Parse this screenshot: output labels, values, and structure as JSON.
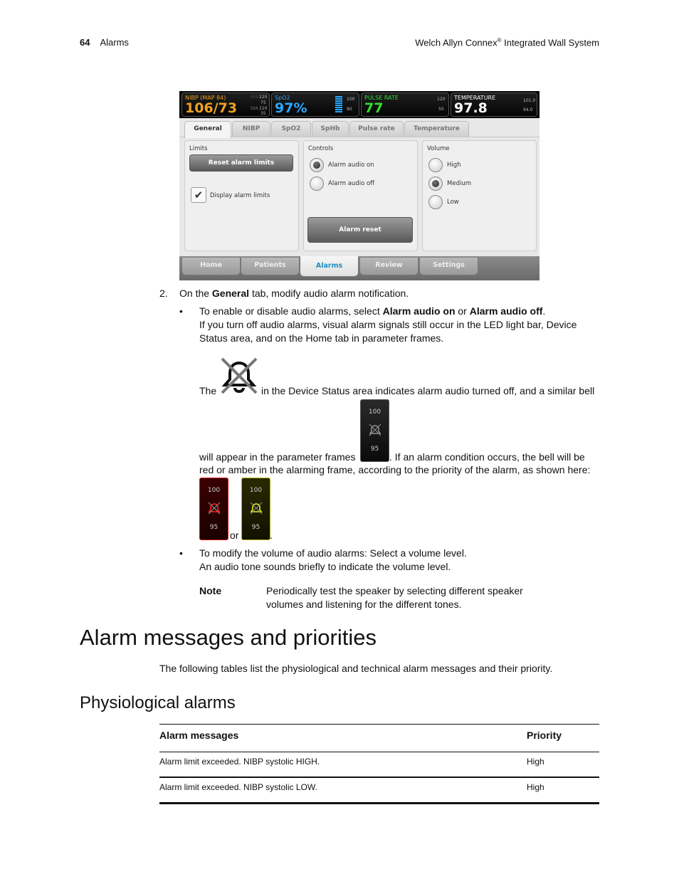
{
  "header": {
    "page_number": "64",
    "section": "Alarms",
    "product_prefix": "Welch Allyn Connex",
    "product_reg": "®",
    "product_suffix": " Integrated Wall System"
  },
  "device": {
    "vitals": [
      {
        "label": "NIBP (MAP 84)",
        "value": "106/73",
        "color": "#f0a020",
        "limits": [
          "SYS",
          "220",
          "75",
          "DIA",
          "110",
          "35"
        ]
      },
      {
        "label": "SpO2",
        "value": "97%",
        "color": "#28a8ff",
        "limits": [
          "100",
          "90"
        ]
      },
      {
        "label": "PULSE RATE",
        "value": "77",
        "color": "#30e030",
        "limits": [
          "120",
          "50"
        ]
      },
      {
        "label": "TEMPERATURE",
        "value": "97.8",
        "color": "#ffffff",
        "limits": [
          "101.0",
          "94.0"
        ]
      }
    ],
    "tabs": [
      "General",
      "NIBP",
      "SpO2",
      "SpHb",
      "Pulse rate",
      "Temperature"
    ],
    "active_tab": "General",
    "limits_panel": {
      "title": "Limits",
      "reset_button": "Reset alarm limits",
      "checkbox_label": "Display alarm limits",
      "checked": true
    },
    "controls_panel": {
      "title": "Controls",
      "options": [
        "Alarm audio on",
        "Alarm audio off"
      ],
      "selected": "Alarm audio on",
      "reset_button": "Alarm reset"
    },
    "volume_panel": {
      "title": "Volume",
      "options": [
        "High",
        "Medium",
        "Low"
      ],
      "selected": "Medium"
    },
    "nav_tabs": [
      "Home",
      "Patients",
      "Alarms",
      "Review",
      "Settings"
    ],
    "active_nav": "Alarms"
  },
  "step": {
    "number": "2.",
    "pre": "On the ",
    "bold": "General",
    "post": " tab, modify audio alarm notification.",
    "bullet1": {
      "a": "To enable or disable audio alarms, select ",
      "b1": "Alarm audio on",
      "c": " or ",
      "b2": "Alarm audio off",
      "d": ".",
      "line2": "If you turn off audio alarms, visual alarm signals still occur in the LED light bar, Device",
      "line3": "Status area, and on the Home tab in parameter frames.",
      "the": "The",
      "after_bell": "in the Device Status area indicates alarm audio turned off, and a similar bell",
      "will_appear": "will appear in the parameter frames",
      "if_alarm": ". If an alarm condition occurs, the bell will be",
      "red_or_amber": "red or amber in the alarming frame, according to the priority of the alarm, as shown here:",
      "or": "or",
      "period": "."
    },
    "frames": {
      "upper": "100",
      "lower": "95",
      "red": "#e01010",
      "amber": "#e0e010"
    },
    "bullet2": {
      "line1": "To modify the volume of audio alarms: Select a volume level.",
      "line2": "An audio tone sounds briefly to indicate the volume level."
    },
    "note": {
      "label": "Note",
      "line1": "Periodically test the speaker by selecting different speaker",
      "line2": "volumes and listening for the different tones."
    }
  },
  "section_title": "Alarm messages and priorities",
  "section_intro": "The following tables list the physiological and technical alarm messages and their priority.",
  "subsection_title": "Physiological alarms",
  "table": {
    "headers": [
      "Alarm messages",
      "Priority"
    ],
    "rows": [
      [
        "Alarm limit exceeded. NIBP systolic HIGH.",
        "High"
      ],
      [
        "Alarm limit exceeded. NIBP systolic LOW.",
        "High"
      ]
    ]
  }
}
